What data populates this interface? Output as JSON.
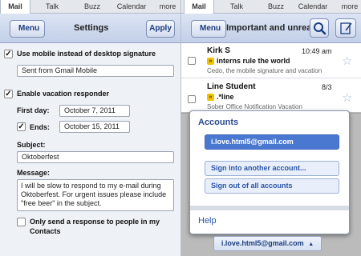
{
  "left": {
    "tabs": [
      "Mail",
      "Talk",
      "Buzz",
      "Calendar",
      "more"
    ],
    "toolbar": {
      "back": "Menu",
      "title": "Settings",
      "apply": "Apply"
    },
    "mobile_sig": {
      "checked": true,
      "label": "Use mobile instead of desktop signature",
      "value": "Sent from Gmail Mobile"
    },
    "vacation": {
      "checked": true,
      "label": "Enable vacation responder",
      "first_day_label": "First day:",
      "first_day": "October 7, 2011",
      "ends_checked": true,
      "ends_label": "Ends:",
      "ends": "October 15, 2011",
      "subject_label": "Subject:",
      "subject": "Oktoberfest",
      "message_label": "Message:",
      "message": "I will be slow to respond to my e-mail during Oktoberfest. For urgent issues please include \"free beer\" in the subject.",
      "contacts_checked": false,
      "contacts_label": "Only send a response to people in my Contacts"
    },
    "checkmark": "✓"
  },
  "right": {
    "tabs": [
      "Mail",
      "Talk",
      "Buzz",
      "Calendar",
      "more"
    ],
    "toolbar": {
      "back": "Menu",
      "title": "Important and unread"
    },
    "emails": [
      {
        "sender": "Kirk S",
        "time": "10:49 am",
        "subject": "interns rule the world",
        "snippet": "Cedo, the mobile signature and vacation"
      },
      {
        "sender": "Line Student",
        "count": "8/3",
        "subject": ".*line",
        "snippet": "Sober Office Notification Vacation"
      }
    ],
    "accounts": {
      "title": "Accounts",
      "current": "i.love.html5@gmail.com",
      "sign_in": "Sign into another account...",
      "sign_out": "Sign out of all accounts",
      "help": "Help",
      "switcher": "i.love.html5@gmail.com"
    }
  },
  "colors": {
    "accent": "#4a78d1",
    "important": "#f2c200",
    "toolbar": "#c2cfe8"
  }
}
